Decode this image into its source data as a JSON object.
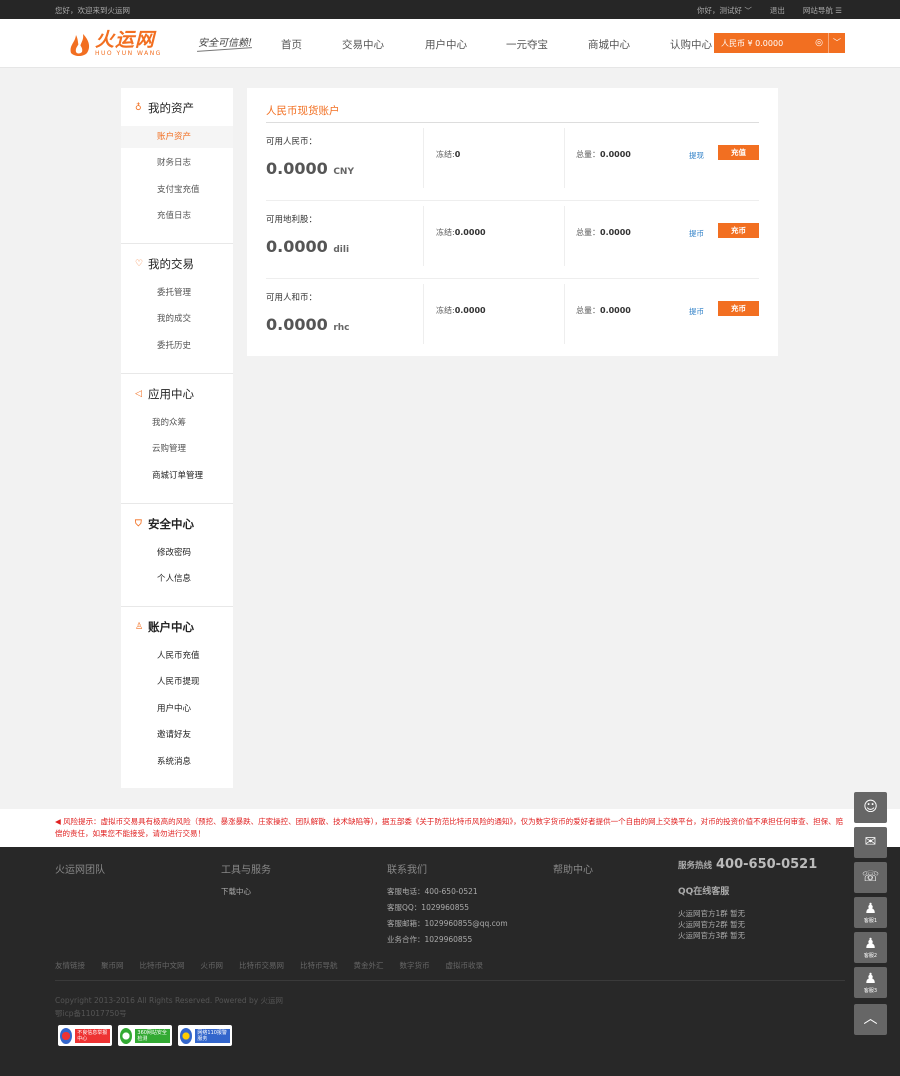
{
  "topbar": {
    "welcome": "您好，欢迎来到火运网",
    "greeting": "你好，测试好 ﹀",
    "logout": "退出",
    "site_nav": "网站导航 ☰"
  },
  "header": {
    "logo_cn": "火运网",
    "logo_en": "HUO YUN WANG",
    "slogan": "安全可信赖!",
    "nav": [
      "首页",
      "交易中心",
      "用户中心",
      "一元夺宝",
      "商城中心",
      "认购中心"
    ],
    "balance": "人民币 ¥ 0.0000"
  },
  "sidebar": {
    "assets": {
      "title": "我的资产",
      "items": [
        "账户资产",
        "财务日志",
        "支付宝充值",
        "充值日志"
      ]
    },
    "trade": {
      "title": "我的交易",
      "items": [
        "委托管理",
        "我的成交",
        "委托历史"
      ]
    },
    "apps": {
      "title": "应用中心",
      "items": [
        "我的众筹",
        "云购管理",
        "商城订单管理"
      ]
    },
    "security": {
      "title": "安全中心",
      "items": [
        "修改密码",
        "个人信息"
      ]
    },
    "account": {
      "title": "账户中心",
      "items": [
        "人民币充值",
        "人民币提现",
        "用户中心",
        "邀请好友",
        "系统消息"
      ]
    }
  },
  "content": {
    "title": "人民币现货账户",
    "rows": [
      {
        "name": "可用人民币：",
        "amount": "0.0000",
        "unit": "CNY",
        "frozen_label": "冻结:",
        "frozen": "0",
        "total_label": "总量：",
        "total": "0.0000",
        "link": "提现",
        "button": "充值"
      },
      {
        "name": "可用地利股：",
        "amount": "0.0000",
        "unit": "dili",
        "frozen_label": "冻结:",
        "frozen": "0.0000",
        "total_label": "总量：",
        "total": "0.0000",
        "link": "提币",
        "button": "充币"
      },
      {
        "name": "可用人和币：",
        "amount": "0.0000",
        "unit": "rhc",
        "frozen_label": "冻结:",
        "frozen": "0.0000",
        "total_label": "总量：",
        "total": "0.0000",
        "link": "提币",
        "button": "充币"
      }
    ]
  },
  "warning": "风险提示：虚拟币交易具有极高的风险（预挖、暴涨暴跌、庄家操控、团队解散、技术缺陷等），据五部委《关于防范比特币风险的通知》，仅为数字货币的爱好者提供一个自由的网上交换平台，对币的投资价值不承担任何审查、担保、赔偿的责任，如果您不能接受，请勿进行交易！",
  "footer": {
    "col1_title": "火运网团队",
    "col2_title": "工具与服务",
    "col2_items": [
      "下载中心"
    ],
    "col3_title": "联系我们",
    "col3_items": [
      "客服电话：400-650-0521",
      "客服QQ：1029960855",
      "客服邮箱：1029960855@qq.com",
      "业务合作：1029960855"
    ],
    "col4_title": "帮助中心",
    "hotline_label": "服务热线",
    "hotline": "400-650-0521",
    "qq_service": "QQ在线客服",
    "groups": [
      "火运网官方1群 暂无",
      "火运网官方2群 暂无",
      "火运网官方3群 暂无"
    ],
    "friends": [
      "友情链接",
      "聚币网",
      "比特币中文网",
      "火币网",
      "比特币交易网",
      "比特币导航",
      "黄金外汇",
      "数字货币",
      "虚拟币收录"
    ],
    "copyright": "Copyright 2013-2016 All Rights Reserved. Powered by 火运网",
    "icp": "鄂icp备11017750号",
    "badges": [
      "不良信息举报中心",
      "360网站安全检测",
      "网络110报警服务"
    ]
  },
  "float": {
    "kefu1": "客服1",
    "kefu2": "客服2",
    "kefu3": "客服3"
  }
}
